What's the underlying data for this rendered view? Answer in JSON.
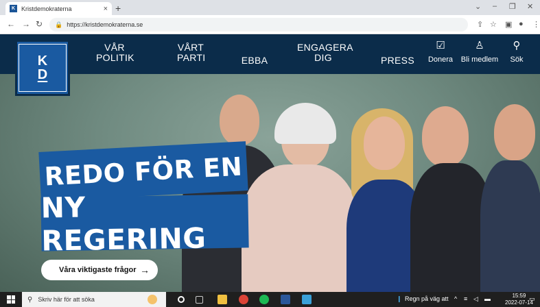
{
  "browser": {
    "tab_title": "Kristdemokraterna",
    "tab_favicon": "K",
    "tab_close": "×",
    "new_tab": "+",
    "url": "https://kristdemokraterna.se",
    "window_controls": [
      "⌄",
      "–",
      "❐",
      "✕"
    ]
  },
  "site": {
    "logo": {
      "line1": "K",
      "line2": "D"
    },
    "nav": [
      {
        "line1": "VÅR",
        "line2": "POLITIK"
      },
      {
        "line1": "VÅRT",
        "line2": "PARTI"
      },
      {
        "line1": "EBBA",
        "line2": ""
      },
      {
        "line1": "ENGAGERA",
        "line2": "DIG"
      },
      {
        "line1": "PRESS",
        "line2": ""
      }
    ],
    "tools": [
      {
        "icon": "donate-icon",
        "label": "Donera"
      },
      {
        "icon": "user-add-icon",
        "label": "Bli medlem"
      },
      {
        "icon": "search-icon",
        "label": "Sök"
      }
    ],
    "headline": {
      "line1": "REDO FÖR EN",
      "line2": "NY REGERING"
    },
    "cta": {
      "label": "Våra viktigaste frågor",
      "arrow": "→"
    }
  },
  "taskbar": {
    "search_placeholder": "Skriv här för att söka",
    "weather": "Regn på väg att",
    "time": "15:59",
    "date": "2022-07-14"
  },
  "colors": {
    "brand_blue": "#1a5aa1",
    "nav_navy": "#0b2c4a"
  }
}
